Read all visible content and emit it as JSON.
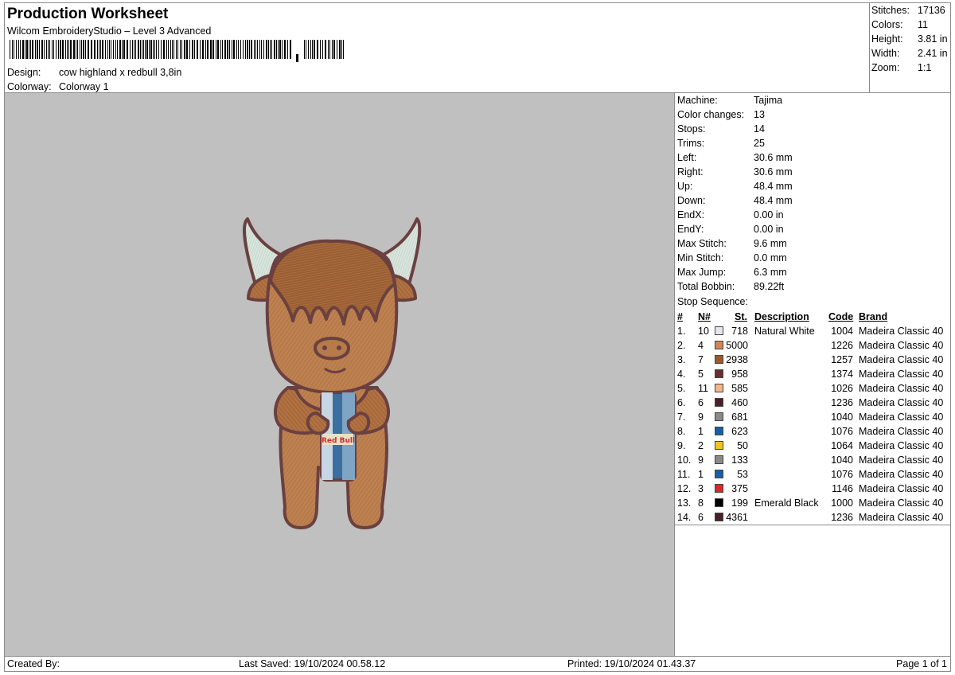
{
  "header": {
    "title": "Production Worksheet",
    "software": "Wilcom EmbroideryStudio – Level 3 Advanced",
    "design_label": "Design:",
    "design_value": "cow highland x redbull 3,8in",
    "colorway_label": "Colorway:",
    "colorway_value": "Colorway 1"
  },
  "stats": [
    {
      "label": "Stitches:",
      "value": "17136"
    },
    {
      "label": "Colors:",
      "value": "11"
    },
    {
      "label": "Height:",
      "value": "3.81 in"
    },
    {
      "label": "Width:",
      "value": "2.41 in"
    },
    {
      "label": "Zoom:",
      "value": "1:1"
    }
  ],
  "machine_info": [
    {
      "label": "Machine:",
      "value": "Tajima"
    },
    {
      "label": "Color changes:",
      "value": "13"
    },
    {
      "label": "Stops:",
      "value": "14"
    },
    {
      "label": "Trims:",
      "value": "25"
    },
    {
      "label": "Left:",
      "value": "30.6 mm"
    },
    {
      "label": "Right:",
      "value": "30.6 mm"
    },
    {
      "label": "Up:",
      "value": "48.4 mm"
    },
    {
      "label": "Down:",
      "value": "48.4 mm"
    },
    {
      "label": "EndX:",
      "value": "0.00 in"
    },
    {
      "label": "EndY:",
      "value": "0.00 in"
    },
    {
      "label": "Max Stitch:",
      "value": "9.6 mm"
    },
    {
      "label": "Min Stitch:",
      "value": "0.0 mm"
    },
    {
      "label": "Max Jump:",
      "value": "6.3 mm"
    },
    {
      "label": "Total Bobbin:",
      "value": "89.22ft"
    }
  ],
  "stop_sequence": {
    "title": "Stop Sequence:",
    "columns": {
      "num": "#",
      "n": "N#",
      "st": "St.",
      "description": "Description",
      "code": "Code",
      "brand": "Brand"
    },
    "rows": [
      {
        "num": "1.",
        "n": "10",
        "color": "#e8e6ea",
        "st": "718",
        "description": "Natural White",
        "code": "1004",
        "brand": "Madeira Classic 40"
      },
      {
        "num": "2.",
        "n": "4",
        "color": "#d18656",
        "st": "5000",
        "description": "",
        "code": "1226",
        "brand": "Madeira Classic 40"
      },
      {
        "num": "3.",
        "n": "7",
        "color": "#9a5a2e",
        "st": "2938",
        "description": "",
        "code": "1257",
        "brand": "Madeira Classic 40"
      },
      {
        "num": "4.",
        "n": "5",
        "color": "#6b2d2d",
        "st": "958",
        "description": "",
        "code": "1374",
        "brand": "Madeira Classic 40"
      },
      {
        "num": "5.",
        "n": "11",
        "color": "#f2b88c",
        "st": "585",
        "description": "",
        "code": "1026",
        "brand": "Madeira Classic 40"
      },
      {
        "num": "6.",
        "n": "6",
        "color": "#4a2028",
        "st": "460",
        "description": "",
        "code": "1236",
        "brand": "Madeira Classic 40"
      },
      {
        "num": "7.",
        "n": "9",
        "color": "#8a8a8a",
        "st": "681",
        "description": "",
        "code": "1040",
        "brand": "Madeira Classic 40"
      },
      {
        "num": "8.",
        "n": "1",
        "color": "#1a5ea8",
        "st": "623",
        "description": "",
        "code": "1076",
        "brand": "Madeira Classic 40"
      },
      {
        "num": "9.",
        "n": "2",
        "color": "#f2c417",
        "st": "50",
        "description": "",
        "code": "1064",
        "brand": "Madeira Classic 40"
      },
      {
        "num": "10.",
        "n": "9",
        "color": "#8a8a8a",
        "st": "133",
        "description": "",
        "code": "1040",
        "brand": "Madeira Classic 40"
      },
      {
        "num": "11.",
        "n": "1",
        "color": "#1a5ea8",
        "st": "53",
        "description": "",
        "code": "1076",
        "brand": "Madeira Classic 40"
      },
      {
        "num": "12.",
        "n": "3",
        "color": "#d42a2a",
        "st": "375",
        "description": "",
        "code": "1146",
        "brand": "Madeira Classic 40"
      },
      {
        "num": "13.",
        "n": "8",
        "color": "#000000",
        "st": "199",
        "description": "Emerald Black",
        "code": "1000",
        "brand": "Madeira Classic 40"
      },
      {
        "num": "14.",
        "n": "6",
        "color": "#4a2028",
        "st": "4361",
        "description": "",
        "code": "1236",
        "brand": "Madeira Classic 40"
      }
    ]
  },
  "footer": {
    "created_by": "Created By:",
    "last_saved": "Last Saved: 19/10/2024 00.58.12",
    "printed": "Printed: 19/10/2024 01.43.37",
    "page": "Page 1 of 1"
  },
  "design_preview": {
    "background": "#c0c0c0",
    "can_text": "Red Bull"
  }
}
